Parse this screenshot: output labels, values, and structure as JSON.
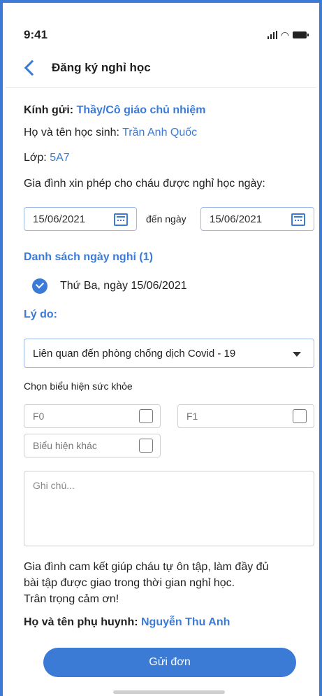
{
  "status": {
    "time": "9:41"
  },
  "header": {
    "title": "Đăng ký nghỉ học"
  },
  "form": {
    "recipient_label": "Kính gửi:",
    "recipient_value": "Thầy/Cô giáo chủ nhiệm",
    "student_label": "Họ và tên học sinh:",
    "student_value": "Trần Anh Quốc",
    "class_label": "Lớp:",
    "class_value": "5A7",
    "request_text": "Gia đình xin phép cho cháu được nghỉ học ngày:",
    "date_from": "15/06/2021",
    "date_to_label": "đến ngày",
    "date_to": "15/06/2021",
    "leave_list_title": "Danh sách ngày nghỉ (1)",
    "leave_days": [
      "Thứ Ba, ngày 15/06/2021"
    ],
    "reason_label": "Lý do:",
    "reason_selected": "Liên quan đến phòng chống dịch Covid - 19",
    "health_label": "Chọn biểu hiện sức khỏe",
    "health_options": [
      "F0",
      "F1",
      "Biểu hiện khác"
    ],
    "note_placeholder": "Ghi chú...",
    "commitment_line1": "Gia đình cam kết giúp cháu tự ôn tập, làm đầy đủ",
    "commitment_line2": "bài tập được giao trong thời gian nghỉ học.",
    "thanks": "Trân trọng cảm ơn!",
    "parent_label": "Họ và tên phụ huynh:",
    "parent_value": "Nguyễn Thu Anh",
    "submit_label": "Gửi đơn"
  },
  "colors": {
    "accent": "#3b7bd6"
  }
}
